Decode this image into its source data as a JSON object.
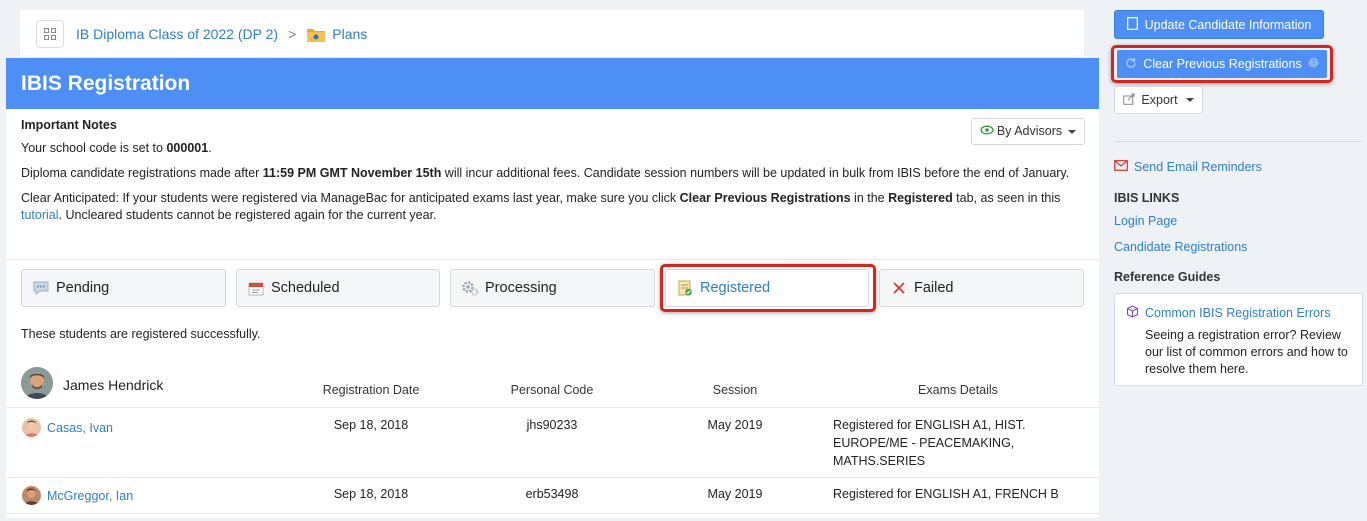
{
  "breadcrumb": {
    "class_label": "IB Diploma Class of 2022 (DP 2)",
    "separator": ">",
    "plans_label": "Plans"
  },
  "panel": {
    "title": "IBIS Registration"
  },
  "notes": {
    "title": "Important Notes",
    "school_code_prefix": "Your school code is set to ",
    "school_code": "000001",
    "school_code_suffix": ".",
    "deadline_prefix": "Diploma candidate registrations made after ",
    "deadline": "11:59 PM GMT November 15th",
    "deadline_suffix": " will incur additional fees. Candidate session numbers will be updated in bulk from IBIS before the end of January.",
    "clear_prefix": "Clear Anticipated: If your students were registered via ManageBac for anticipated exams last year, make sure you click ",
    "clear_bold": "Clear Previous Registrations",
    "clear_mid": " in the ",
    "registered_bold": "Registered",
    "clear_mid2": " tab, as seen in this ",
    "tutorial_link": "tutorial",
    "clear_suffix": ". Uncleared students cannot be registered again for the current year.",
    "advisors_button": "By Advisors"
  },
  "tabs": [
    {
      "label": "Pending",
      "icon": "speech-bubble-icon"
    },
    {
      "label": "Scheduled",
      "icon": "calendar-icon"
    },
    {
      "label": "Processing",
      "icon": "gear-icon"
    },
    {
      "label": "Registered",
      "icon": "registered-doc-icon"
    },
    {
      "label": "Failed",
      "icon": "x-icon"
    }
  ],
  "active_tab": "Registered",
  "section_message": "These students are registered successfully.",
  "table": {
    "advisor_name": "James Hendrick",
    "headers": {
      "registration_date": "Registration Date",
      "personal_code": "Personal Code",
      "session": "Session",
      "exams_details": "Exams Details"
    },
    "rows": [
      {
        "name": "Casas, Ivan",
        "registration_date": "Sep 18, 2018",
        "personal_code": "jhs90233",
        "session": "May 2019",
        "exams_details": "Registered for ENGLISH A1, HIST. EUROPE/ME - PEACEMAKING, MATHS.SERIES"
      },
      {
        "name": "McGreggor, Ian",
        "registration_date": "Sep 18, 2018",
        "personal_code": "erb53498",
        "session": "May 2019",
        "exams_details": "Registered for ENGLISH A1, FRENCH B"
      }
    ]
  },
  "sidebar": {
    "update_button": "Update Candidate Information",
    "clear_button": "Clear Previous Registrations",
    "export_button": "Export",
    "send_reminders": "Send Email Reminders",
    "ibis_links_heading": "IBIS LINKS",
    "login_page": "Login Page",
    "candidate_registrations": "Candidate Registrations",
    "reference_guides_heading": "Reference Guides",
    "guide_title": "Common IBIS Registration Errors",
    "guide_text": "Seeing a registration error? Review our list of common errors and how to resolve them here."
  },
  "colors": {
    "header_blue": "#4d8ff4",
    "link_blue": "#2f7ec9",
    "highlight_red": "#d3261f",
    "page_bg": "#eef1f6"
  }
}
